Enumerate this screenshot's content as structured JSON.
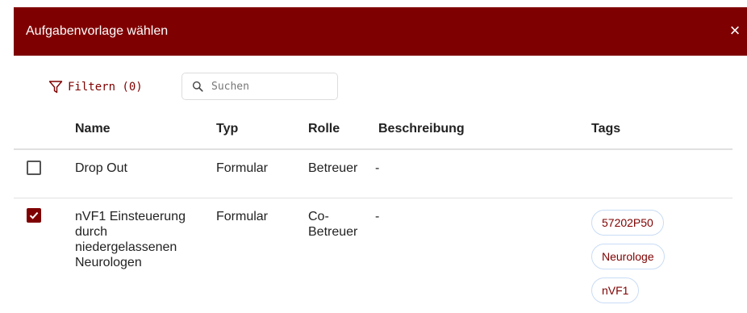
{
  "dialog": {
    "title": "Aufgabenvorlage wählen",
    "close_label": "×"
  },
  "toolbar": {
    "filter_label": "Filtern (0)",
    "search_placeholder": "Suchen"
  },
  "table": {
    "headers": {
      "name": "Name",
      "type": "Typ",
      "role": "Rolle",
      "description": "Beschreibung",
      "tags": "Tags"
    },
    "rows": [
      {
        "checked": false,
        "name": "Drop Out",
        "type": "Formular",
        "role": "Betreuer",
        "description": "-",
        "tags": []
      },
      {
        "checked": true,
        "name_lines": [
          "nVF1 Einsteuerung",
          "durch",
          "niedergelassenen",
          "Neurologen"
        ],
        "type": "Formular",
        "role_lines": [
          "Co-",
          "Betreuer"
        ],
        "description": "-",
        "tags": [
          "57202P50",
          "Neurologe",
          "nVF1"
        ]
      }
    ]
  },
  "colors": {
    "brand": "#7f0000",
    "tag_border": "#c9dcf5"
  },
  "icons": {
    "filter": "funnel-icon",
    "search": "search-icon",
    "close": "close-icon",
    "check": "checkmark-icon"
  }
}
